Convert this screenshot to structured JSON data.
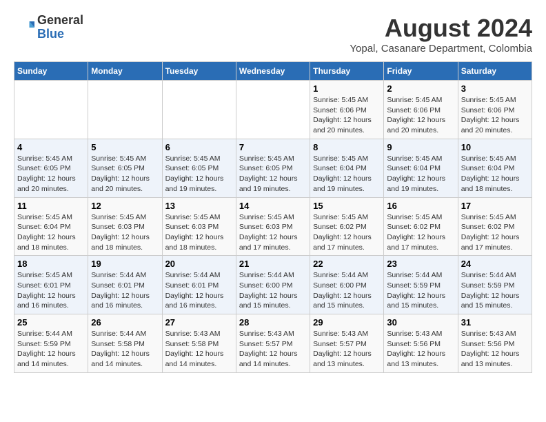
{
  "logo": {
    "general": "General",
    "blue": "Blue"
  },
  "title": {
    "month_year": "August 2024",
    "location": "Yopal, Casanare Department, Colombia"
  },
  "headers": [
    "Sunday",
    "Monday",
    "Tuesday",
    "Wednesday",
    "Thursday",
    "Friday",
    "Saturday"
  ],
  "weeks": [
    [
      {
        "day": "",
        "info": ""
      },
      {
        "day": "",
        "info": ""
      },
      {
        "day": "",
        "info": ""
      },
      {
        "day": "",
        "info": ""
      },
      {
        "day": "1",
        "info": "Sunrise: 5:45 AM\nSunset: 6:06 PM\nDaylight: 12 hours\nand 20 minutes."
      },
      {
        "day": "2",
        "info": "Sunrise: 5:45 AM\nSunset: 6:06 PM\nDaylight: 12 hours\nand 20 minutes."
      },
      {
        "day": "3",
        "info": "Sunrise: 5:45 AM\nSunset: 6:06 PM\nDaylight: 12 hours\nand 20 minutes."
      }
    ],
    [
      {
        "day": "4",
        "info": "Sunrise: 5:45 AM\nSunset: 6:05 PM\nDaylight: 12 hours\nand 20 minutes."
      },
      {
        "day": "5",
        "info": "Sunrise: 5:45 AM\nSunset: 6:05 PM\nDaylight: 12 hours\nand 20 minutes."
      },
      {
        "day": "6",
        "info": "Sunrise: 5:45 AM\nSunset: 6:05 PM\nDaylight: 12 hours\nand 19 minutes."
      },
      {
        "day": "7",
        "info": "Sunrise: 5:45 AM\nSunset: 6:05 PM\nDaylight: 12 hours\nand 19 minutes."
      },
      {
        "day": "8",
        "info": "Sunrise: 5:45 AM\nSunset: 6:04 PM\nDaylight: 12 hours\nand 19 minutes."
      },
      {
        "day": "9",
        "info": "Sunrise: 5:45 AM\nSunset: 6:04 PM\nDaylight: 12 hours\nand 19 minutes."
      },
      {
        "day": "10",
        "info": "Sunrise: 5:45 AM\nSunset: 6:04 PM\nDaylight: 12 hours\nand 18 minutes."
      }
    ],
    [
      {
        "day": "11",
        "info": "Sunrise: 5:45 AM\nSunset: 6:04 PM\nDaylight: 12 hours\nand 18 minutes."
      },
      {
        "day": "12",
        "info": "Sunrise: 5:45 AM\nSunset: 6:03 PM\nDaylight: 12 hours\nand 18 minutes."
      },
      {
        "day": "13",
        "info": "Sunrise: 5:45 AM\nSunset: 6:03 PM\nDaylight: 12 hours\nand 18 minutes."
      },
      {
        "day": "14",
        "info": "Sunrise: 5:45 AM\nSunset: 6:03 PM\nDaylight: 12 hours\nand 17 minutes."
      },
      {
        "day": "15",
        "info": "Sunrise: 5:45 AM\nSunset: 6:02 PM\nDaylight: 12 hours\nand 17 minutes."
      },
      {
        "day": "16",
        "info": "Sunrise: 5:45 AM\nSunset: 6:02 PM\nDaylight: 12 hours\nand 17 minutes."
      },
      {
        "day": "17",
        "info": "Sunrise: 5:45 AM\nSunset: 6:02 PM\nDaylight: 12 hours\nand 17 minutes."
      }
    ],
    [
      {
        "day": "18",
        "info": "Sunrise: 5:45 AM\nSunset: 6:01 PM\nDaylight: 12 hours\nand 16 minutes."
      },
      {
        "day": "19",
        "info": "Sunrise: 5:44 AM\nSunset: 6:01 PM\nDaylight: 12 hours\nand 16 minutes."
      },
      {
        "day": "20",
        "info": "Sunrise: 5:44 AM\nSunset: 6:01 PM\nDaylight: 12 hours\nand 16 minutes."
      },
      {
        "day": "21",
        "info": "Sunrise: 5:44 AM\nSunset: 6:00 PM\nDaylight: 12 hours\nand 15 minutes."
      },
      {
        "day": "22",
        "info": "Sunrise: 5:44 AM\nSunset: 6:00 PM\nDaylight: 12 hours\nand 15 minutes."
      },
      {
        "day": "23",
        "info": "Sunrise: 5:44 AM\nSunset: 5:59 PM\nDaylight: 12 hours\nand 15 minutes."
      },
      {
        "day": "24",
        "info": "Sunrise: 5:44 AM\nSunset: 5:59 PM\nDaylight: 12 hours\nand 15 minutes."
      }
    ],
    [
      {
        "day": "25",
        "info": "Sunrise: 5:44 AM\nSunset: 5:59 PM\nDaylight: 12 hours\nand 14 minutes."
      },
      {
        "day": "26",
        "info": "Sunrise: 5:44 AM\nSunset: 5:58 PM\nDaylight: 12 hours\nand 14 minutes."
      },
      {
        "day": "27",
        "info": "Sunrise: 5:43 AM\nSunset: 5:58 PM\nDaylight: 12 hours\nand 14 minutes."
      },
      {
        "day": "28",
        "info": "Sunrise: 5:43 AM\nSunset: 5:57 PM\nDaylight: 12 hours\nand 14 minutes."
      },
      {
        "day": "29",
        "info": "Sunrise: 5:43 AM\nSunset: 5:57 PM\nDaylight: 12 hours\nand 13 minutes."
      },
      {
        "day": "30",
        "info": "Sunrise: 5:43 AM\nSunset: 5:56 PM\nDaylight: 12 hours\nand 13 minutes."
      },
      {
        "day": "31",
        "info": "Sunrise: 5:43 AM\nSunset: 5:56 PM\nDaylight: 12 hours\nand 13 minutes."
      }
    ]
  ]
}
